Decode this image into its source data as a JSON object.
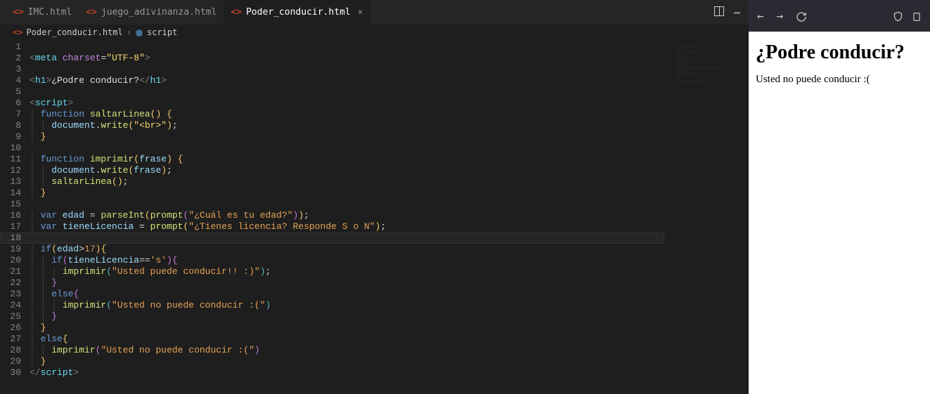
{
  "tabs": {
    "items": [
      {
        "label": "IMC.html"
      },
      {
        "label": "juego_adivinanza.html"
      },
      {
        "label": "Poder_conducir.html"
      }
    ],
    "active_index": 2
  },
  "breadcrumb": {
    "file": "Poder_conducir.html",
    "symbol": "script"
  },
  "code": {
    "line_count": 30,
    "lines": [
      "",
      "<meta charset=\"UTF-8\">",
      "",
      "<h1>¿Podre conducir?</h1>",
      "",
      "<script>",
      "  function saltarLinea() {",
      "    document.write(\"<br>\");",
      "  }",
      "",
      "  function imprimir(frase) {",
      "    document.write(frase);",
      "    saltarLinea();",
      "  }",
      "",
      "  var edad = parseInt(prompt(\"¿Cuál es tu edad?\"));",
      "  var tieneLicencia = prompt(\"¿Tienes licencia? Responde S o N\");",
      "",
      "  if(edad>17){",
      "    if(tieneLicencia=='s'){",
      "      imprimir(\"Usted puede conducir!! :)\");",
      "    }",
      "    else{",
      "      imprimir(\"Usted no puede conducir :(\")",
      "    }",
      "  }",
      "  else{",
      "    imprimir(\"Usted no puede conducir :(\")",
      "  }",
      "</script>"
    ],
    "current_line": 18
  },
  "preview": {
    "heading": "¿Podre conducir?",
    "body": "Usted no puede conducir :("
  }
}
